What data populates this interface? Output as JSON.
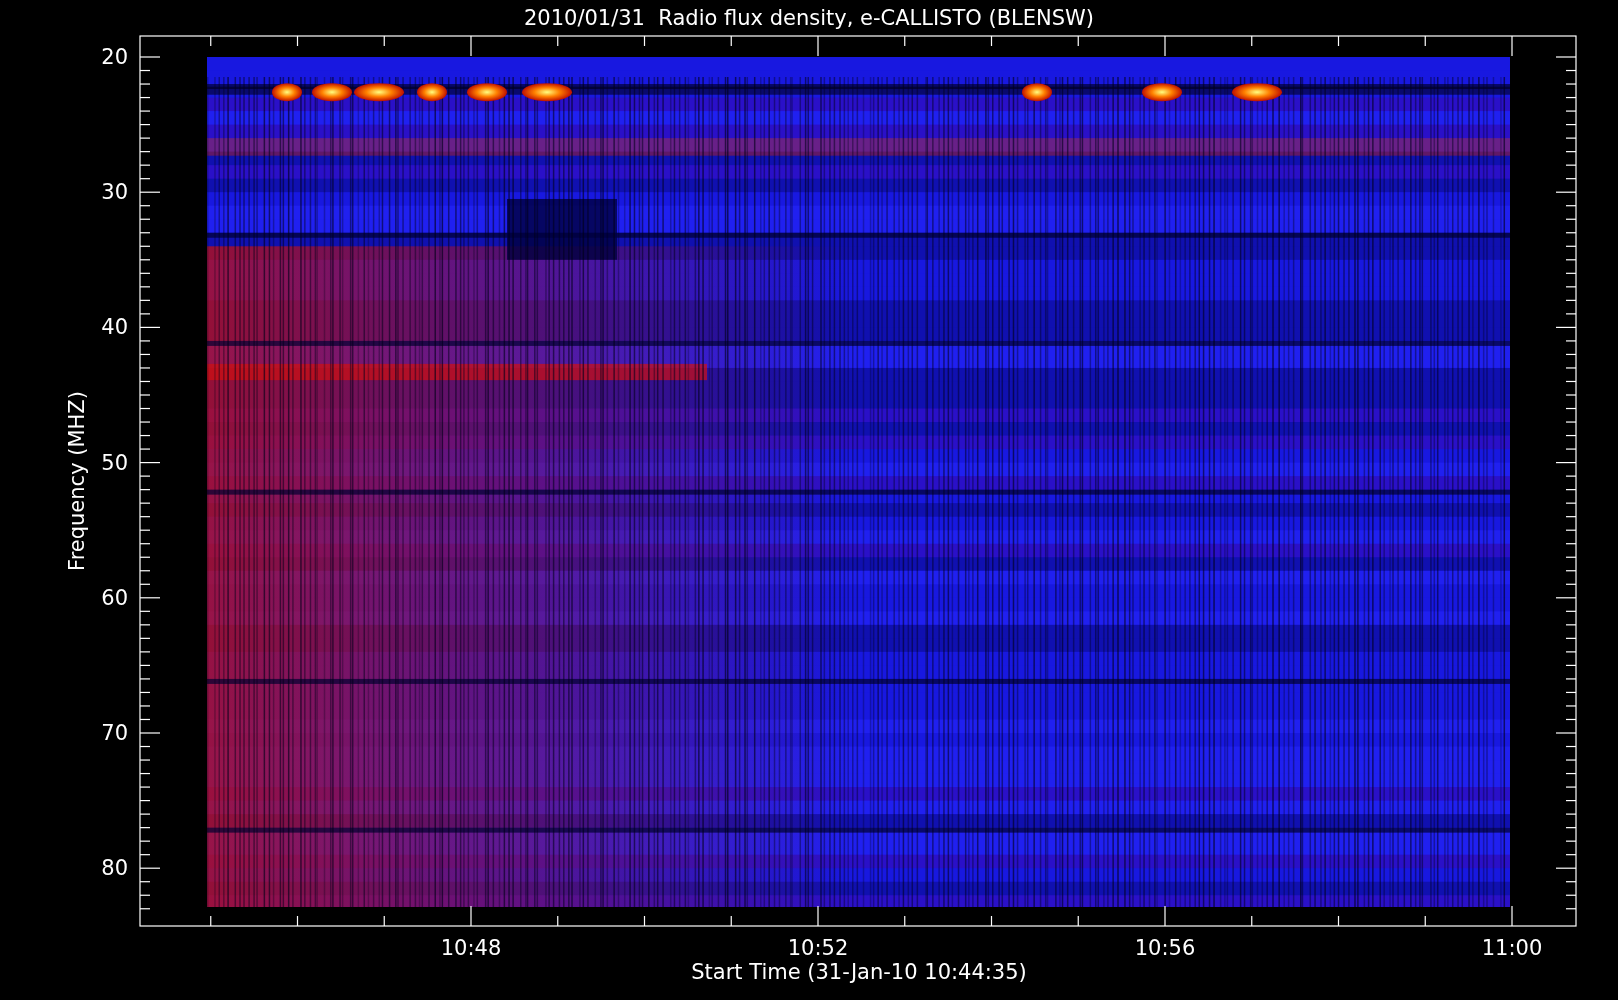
{
  "title": "2010/01/31  Radio flux density, e-CALLISTO (BLENSW)",
  "y_axis": {
    "label": "Frequency (MHZ)",
    "ticks": [
      "20",
      "30",
      "40",
      "50",
      "60",
      "70",
      "80"
    ]
  },
  "x_axis": {
    "label": "Start Time (31-Jan-10 10:44:35)",
    "ticks": [
      "10:48",
      "10:52",
      "10:56",
      "11:00"
    ]
  }
}
